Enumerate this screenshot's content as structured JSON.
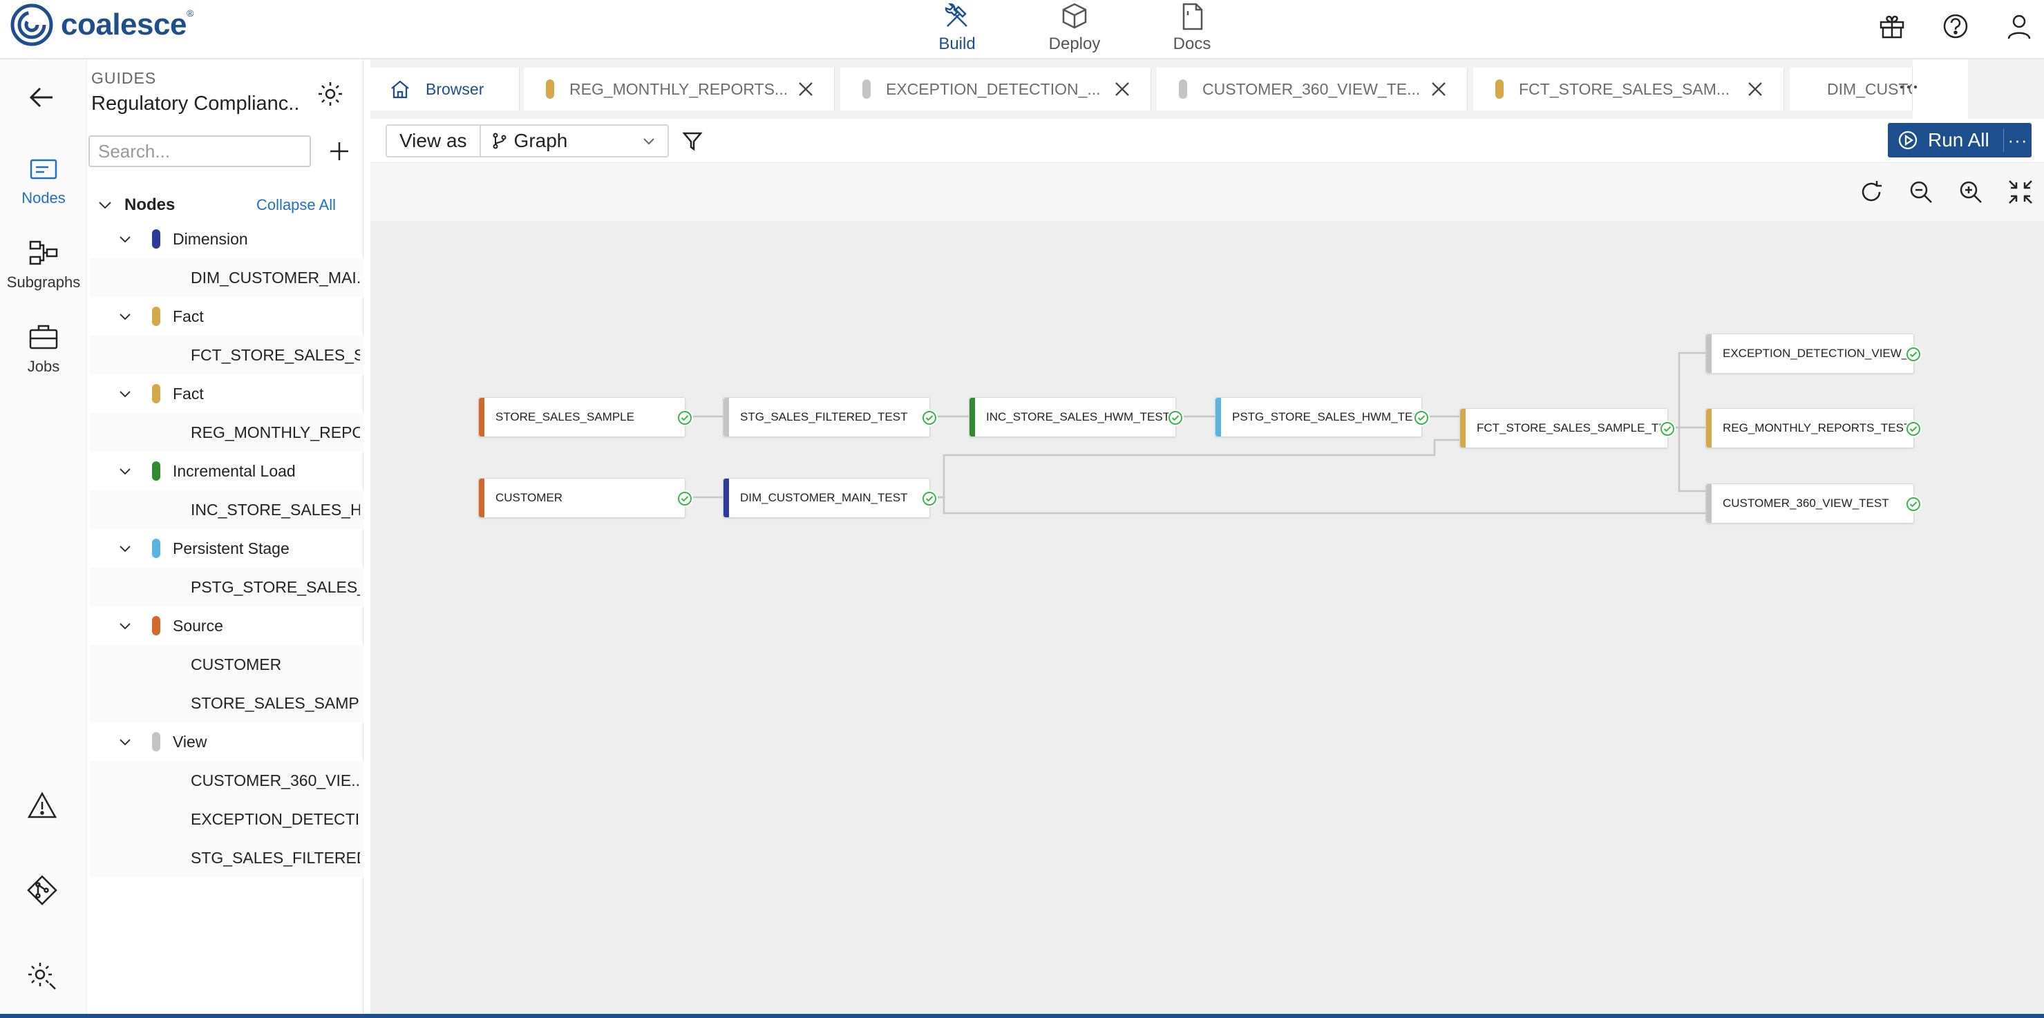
{
  "app": {
    "brand": "coalesce",
    "reg_mark": "®"
  },
  "topnav": {
    "items": [
      {
        "label": "Build",
        "icon": "build-icon",
        "active": true
      },
      {
        "label": "Deploy",
        "icon": "deploy-icon",
        "active": false
      },
      {
        "label": "Docs",
        "icon": "docs-icon",
        "active": false
      }
    ],
    "right_icons": [
      "gift-icon",
      "help-icon",
      "user-icon"
    ]
  },
  "rail": {
    "items": [
      {
        "label": "Nodes",
        "icon": "nodes-icon",
        "active": true
      },
      {
        "label": "Subgraphs",
        "icon": "subgraphs-icon",
        "active": false
      },
      {
        "label": "Jobs",
        "icon": "jobs-icon",
        "active": false
      }
    ],
    "bottom_icons": [
      "warning-icon",
      "git-icon",
      "settings-icon"
    ]
  },
  "panel": {
    "section_label": "GUIDES",
    "title": "Regulatory Complianc...",
    "search_placeholder": "Search...",
    "tree_header": "Nodes",
    "collapse_all": "Collapse All",
    "groups": [
      {
        "label": "Dimension",
        "color": "#2b3a9b",
        "items": [
          "DIM_CUSTOMER_MAI..."
        ]
      },
      {
        "label": "Fact",
        "color": "#d6a84a",
        "items": [
          "FCT_STORE_SALES_S..."
        ]
      },
      {
        "label": "Fact",
        "color": "#d6a84a",
        "items": [
          "REG_MONTHLY_REPO..."
        ]
      },
      {
        "label": "Incremental Load",
        "color": "#2e8b2e",
        "items": [
          "INC_STORE_SALES_H..."
        ]
      },
      {
        "label": "Persistent Stage",
        "color": "#5ab4e0",
        "items": [
          "PSTG_STORE_SALES_..."
        ]
      },
      {
        "label": "Source",
        "color": "#d2692a",
        "items": [
          "CUSTOMER",
          "STORE_SALES_SAMPLE"
        ]
      },
      {
        "label": "View",
        "color": "#c4c4c4",
        "items": [
          "CUSTOMER_360_VIE...",
          "EXCEPTION_DETECTI...",
          "STG_SALES_FILTERED..."
        ]
      }
    ]
  },
  "tabs": [
    {
      "label": "Browser",
      "type": "home"
    },
    {
      "label": "REG_MONTHLY_REPORTS...",
      "color": "#d6a84a"
    },
    {
      "label": "EXCEPTION_DETECTION_...",
      "color": "#c4c4c4"
    },
    {
      "label": "CUSTOMER_360_VIEW_TE...",
      "color": "#c4c4c4"
    },
    {
      "label": "FCT_STORE_SALES_SAM...",
      "color": "#d6a84a"
    },
    {
      "label": "DIM_CUSTO",
      "color": "#2b3a9b"
    }
  ],
  "toolbar": {
    "view_as_label": "View as",
    "view_as_value": "Graph",
    "run_all": "Run All",
    "run_more": "···"
  },
  "graph": {
    "nodes": [
      {
        "id": "STORE_SALES_SAMPLE",
        "label": "STORE_SALES_SAMPLE",
        "color": "#d2692a"
      },
      {
        "id": "STG_SALES_FILTERED_TEST",
        "label": "STG_SALES_FILTERED_TEST",
        "color": "#c4c4c4"
      },
      {
        "id": "INC_STORE_SALES_HWM_TEST",
        "label": "INC_STORE_SALES_HWM_TEST",
        "color": "#2e8b2e"
      },
      {
        "id": "PSTG_STORE_SALES_HWM_TEST",
        "label": "PSTG_STORE_SALES_HWM_TEST",
        "color": "#5ab4e0"
      },
      {
        "id": "FCT_STORE_SALES_SAMPLE_TEST",
        "label": "FCT_STORE_SALES_SAMPLE_TE...",
        "color": "#d6a84a"
      },
      {
        "id": "EXCEPTION_DETECTION_VIEW",
        "label": "EXCEPTION_DETECTION_VIEW_...",
        "color": "#c4c4c4"
      },
      {
        "id": "REG_MONTHLY_REPORTS_TEST",
        "label": "REG_MONTHLY_REPORTS_TEST",
        "color": "#d6a84a"
      },
      {
        "id": "CUSTOMER_360_VIEW_TEST",
        "label": "CUSTOMER_360_VIEW_TEST",
        "color": "#c4c4c4"
      },
      {
        "id": "CUSTOMER",
        "label": "CUSTOMER",
        "color": "#d2692a"
      },
      {
        "id": "DIM_CUSTOMER_MAIN_TEST",
        "label": "DIM_CUSTOMER_MAIN_TEST",
        "color": "#2b3a9b"
      }
    ],
    "status": "success",
    "check_color": "#3bb54a"
  }
}
